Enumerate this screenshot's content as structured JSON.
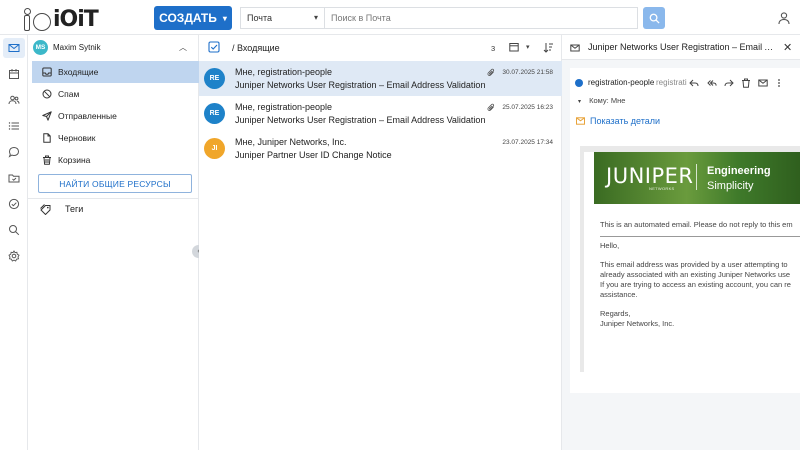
{
  "app": {
    "logo_text": "iOiT"
  },
  "toolbar": {
    "create_label": "СОЗДАТЬ",
    "search_scope": "Почта",
    "search_placeholder": "Поиск в Почта"
  },
  "account": {
    "initials": "MS",
    "name": "Maxim Sytnik",
    "avatar_color": "#3cb8c9"
  },
  "folders": [
    {
      "label": "Входящие",
      "icon": "inbox-icon",
      "active": true
    },
    {
      "label": "Спам",
      "icon": "spam-icon",
      "active": false
    },
    {
      "label": "Отправленные",
      "icon": "sent-icon",
      "active": false
    },
    {
      "label": "Черновик",
      "icon": "draft-icon",
      "active": false
    },
    {
      "label": "Корзина",
      "icon": "trash-icon",
      "active": false
    }
  ],
  "shared_resources_label": "НАЙТИ ОБЩИЕ РЕСУРСЫ",
  "tags_label": "Теги",
  "list": {
    "title": "/ Входящие",
    "count": "3"
  },
  "messages": [
    {
      "initials": "RE",
      "avatar_color": "#1e82c9",
      "from": "Мне, registration-people",
      "subject": "Juniper Networks User Registration – Email Address Validation",
      "date": "30.07.2025 21:58",
      "attachment": true,
      "selected": true
    },
    {
      "initials": "RE",
      "avatar_color": "#1e82c9",
      "from": "Мне, registration-people",
      "subject": "Juniper Networks User Registration – Email Address Validation",
      "date": "25.07.2025 16:23",
      "attachment": true,
      "selected": false
    },
    {
      "initials": "JI",
      "avatar_color": "#f0a62a",
      "from": "Мне, Juniper Networks, Inc.",
      "subject": "Juniper Partner User ID Change Notice",
      "date": "23.07.2025 17:34",
      "attachment": false,
      "selected": false
    }
  ],
  "reader": {
    "subject": "Juniper Networks User Registration – Email Address Validation",
    "sender": "registration-people",
    "sender_secondary": "registrati",
    "to_label": "Кому:",
    "to_value": "Мне",
    "show_details": "Показать детали",
    "banner": {
      "logo": "JUNIPER",
      "sub": "NETWORKS",
      "tag1": "Engineering",
      "tag2": "Simplicity"
    },
    "body_lines": [
      "This is an automated email. Please do not reply to this em",
      "Hello,",
      "This email address was provided by a user attempting to",
      "already associated with an existing Juniper Networks use",
      "If you are trying to access an existing account, you can re",
      "assistance.",
      "Regards,",
      "Juniper Networks, Inc."
    ]
  },
  "colors": {
    "accent": "#1e6fc9",
    "selected_folder": "#bfd5ef",
    "selected_message": "#dfe9f5"
  }
}
